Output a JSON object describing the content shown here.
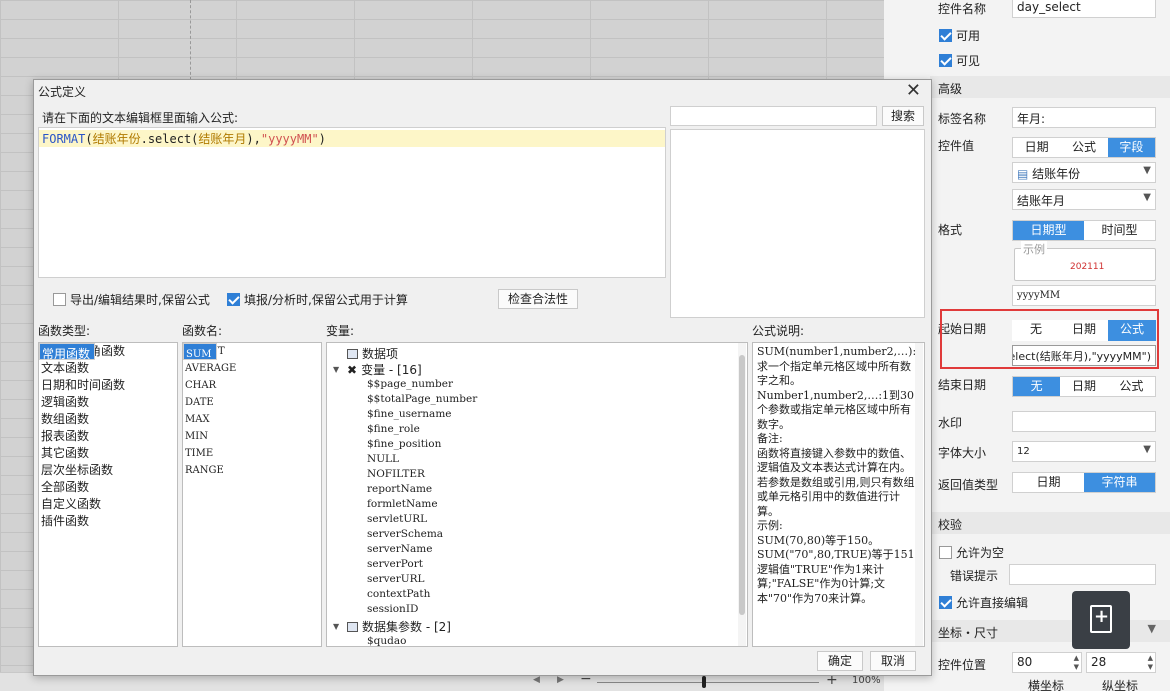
{
  "background": {
    "zoom_label": "100%"
  },
  "right_panel": {
    "control_name_label": "控件名称",
    "control_name_value": "day_select",
    "enabled_label": "可用",
    "visible_label": "可见",
    "advanced_label": "高级",
    "tag_name_label": "标签名称",
    "tag_name_value": "年月:",
    "control_value_label": "控件值",
    "control_value_options": [
      "日期",
      "公式",
      "字段"
    ],
    "control_value_selected": "字段",
    "dataset_select": "结账年份",
    "field_select": "结账年月",
    "format_label": "格式",
    "format_options": [
      "日期型",
      "时间型"
    ],
    "format_selected": "日期型",
    "sample_legend": "示例",
    "sample_value": "202111",
    "format_pattern": "yyyyMM",
    "start_date_label": "起始日期",
    "start_date_options": [
      "无",
      "日期",
      "公式"
    ],
    "start_date_selected": "公式",
    "start_date_formula": "elect(结账年月),\"yyyyMM\")",
    "end_date_label": "结束日期",
    "end_date_options": [
      "无",
      "日期",
      "公式"
    ],
    "end_date_selected": "无",
    "watermark_label": "水印",
    "font_size_label": "字体大小",
    "font_size_value": "12",
    "return_type_label": "返回值类型",
    "return_type_options": [
      "日期",
      "字符串"
    ],
    "return_type_selected": "字符串",
    "validation_label": "校验",
    "allow_empty_label": "允许为空",
    "error_hint_label": "错误提示",
    "allow_edit_label": "允许直接编辑",
    "coords_label": "坐标・尺寸",
    "position_label": "控件位置",
    "pos_x": "80",
    "pos_y": "28",
    "x_caption": "横坐标",
    "y_caption": "纵坐标"
  },
  "dialog": {
    "title": "公式定义",
    "hint": "请在下面的文本编辑框里面输入公式:",
    "formula": {
      "fn": "FORMAT",
      "open": "(",
      "p1": "结账年份",
      "dot": ".select(",
      "p2": "结账年月",
      "close1": "),",
      "str": "\"yyyyMM\"",
      "close2": ")"
    },
    "search_button": "搜索",
    "export_keep_label": "导出/编辑结果时,保留公式",
    "fill_keep_label": "填报/分析时,保留公式用于计算",
    "check_button": "检查合法性",
    "fn_type_label": "函数类型:",
    "fn_name_label": "函数名:",
    "var_label": "变量:",
    "desc_label": "公式说明:",
    "fn_types": [
      "常用函数",
      "数学和三角函数",
      "文本函数",
      "日期和时间函数",
      "逻辑函数",
      "数组函数",
      "报表函数",
      "其它函数",
      "层次坐标函数",
      "全部函数",
      "自定义函数",
      "插件函数"
    ],
    "fn_names": [
      "SUM",
      "COUNT",
      "AVERAGE",
      "CHAR",
      "DATE",
      "MAX",
      "MIN",
      "TIME",
      "RANGE"
    ],
    "tree": {
      "data_item": "数据项",
      "variables": "变量 - [16]",
      "var_items": [
        "$$page_number",
        "$$totalPage_number",
        "$fine_username",
        "$fine_role",
        "$fine_position",
        "NULL",
        "NOFILTER",
        "reportName",
        "formletName",
        "servletURL",
        "serverSchema",
        "serverName",
        "serverPort",
        "serverURL",
        "contextPath",
        "sessionID"
      ],
      "dataset_params": "数据集参数 - [2]",
      "param_items": [
        "$qudao"
      ]
    },
    "description": [
      "SUM(number1,number2,…):求一个指定单元格区域中所有数字之和。",
      "Number1,number2,…:1到30个参数或指定单元格区域中所有数字。",
      "备注:",
      "函数将直接键入参数中的数值、逻辑值及文本表达式计算在内。若参数是数组或引用,则只有数组或单元格引用中的数值进行计算。",
      "示例:",
      "SUM(70,80)等于150。",
      "SUM(\"70\",80,TRUE)等于151,逻辑值\"TRUE\"作为1来计算;\"FALSE\"作为0计算;文本\"70\"作为70来计算。"
    ],
    "ok_button": "确定",
    "cancel_button": "取消"
  }
}
